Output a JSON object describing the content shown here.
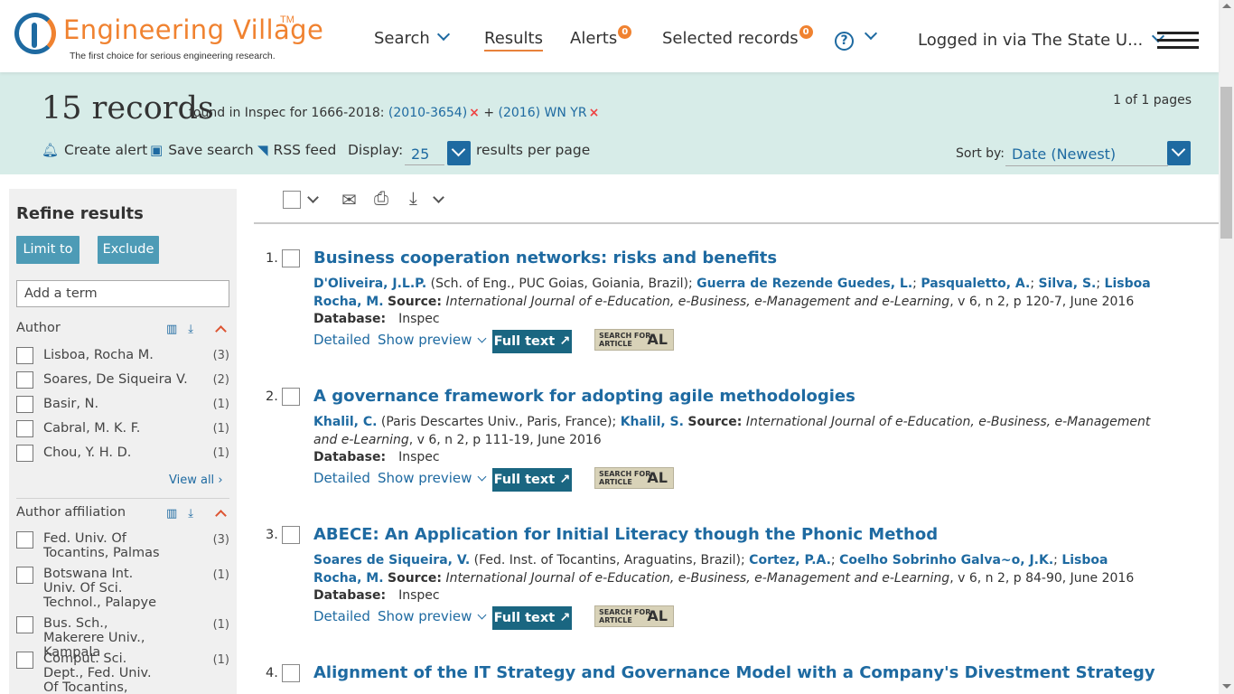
{
  "header": {
    "logo_name": "Engineering Village",
    "logo_tm": "TM",
    "logo_tagline": "The first choice for serious engineering research.",
    "nav": {
      "search": "Search",
      "results": "Results",
      "alerts": "Alerts",
      "alerts_count": "0",
      "selected": "Selected records",
      "selected_count": "0",
      "help": "?",
      "login": "Logged in via The State U..."
    }
  },
  "banner": {
    "count": "15 records",
    "found_text": "found in Inspec for 1666-2018:",
    "query1": "(2010-3654)",
    "plus": "+",
    "query2": "(2016) WN YR",
    "remove_glyph": "×",
    "pages": "1 of 1 pages",
    "create_alert": "Create alert",
    "save_search": "Save search",
    "rss_feed": "RSS feed",
    "display_label": "Display:",
    "display_value": "25",
    "per_page": "results per page",
    "sort_label": "Sort by:",
    "sort_value": "Date (Newest)"
  },
  "sidebar": {
    "title": "Refine results",
    "limit_to": "Limit to",
    "exclude": "Exclude",
    "add_term_placeholder": "Add a term",
    "author_head": "Author",
    "authors": [
      {
        "label": "Lisboa, Rocha M.",
        "count": "(3)"
      },
      {
        "label": "Soares, De Siqueira V.",
        "count": "(2)"
      },
      {
        "label": "Basir, N.",
        "count": "(1)"
      },
      {
        "label": "Cabral, M. K. F.",
        "count": "(1)"
      },
      {
        "label": "Chou, Y. H. D.",
        "count": "(1)"
      }
    ],
    "view_all": "View all",
    "affiliation_head": "Author affiliation",
    "affiliations": [
      {
        "label": "Fed. Univ. Of Tocantins, Palmas",
        "count": "(3)"
      },
      {
        "label": "Botswana Int. Univ. Of Sci. Technol., Palapye",
        "count": "(1)"
      },
      {
        "label": "Bus. Sch., Makerere Univ., Kampala",
        "count": "(1)"
      },
      {
        "label": "Comput. Sci. Dept., Fed. Univ. Of Tocantins, Palmas",
        "count": "(1)"
      }
    ]
  },
  "results": [
    {
      "num": "1.",
      "title": "Business cooperation networks: risks and benefits",
      "author1": "D'Oliveira, J.L.P.",
      "affil": "(Sch. of Eng., PUC Goias, Goiania, Brazil);",
      "others": [
        "Guerra de Rezende Guedes, L.",
        "Pasqualetto, A.",
        "Silva, S.",
        "Lisboa Rocha, M."
      ],
      "source_label": "Source:",
      "journal": "International Journal of e-Education, e-Business, e-Management and e-Learning",
      "citation": ", v 6, n 2, p 120-7, June 2016"
    },
    {
      "num": "2.",
      "title": "A governance framework for adopting agile methodologies",
      "author1": "Khalil, C.",
      "affil": "(Paris Descartes Univ., Paris, France);",
      "others": [
        "Khalil, S."
      ],
      "source_label": "Source:",
      "journal": "International Journal of e-Education, e-Business, e-Management and e-Learning",
      "citation": ", v 6, n 2, p 111-19, June 2016"
    },
    {
      "num": "3.",
      "title": "ABECE: An Application for Initial Literacy though the Phonic Method",
      "author1": "Soares de Siqueira, V.",
      "affil": "(Fed. Inst. of Tocantins, Araguatins, Brazil);",
      "others": [
        "Cortez, P.A.",
        "Coelho Sobrinho Galva~o, J.K.",
        "Lisboa Rocha, M."
      ],
      "source_label": "Source:",
      "journal": "International Journal of e-Education, e-Business, e-Management and e-Learning",
      "citation": ", v 6, n 2, p 84-90, June 2016"
    },
    {
      "num": "4.",
      "title": "Alignment of the IT Strategy and Governance Model with a Company's Divestment Strategy"
    }
  ],
  "result_common": {
    "database_label": "Database:",
    "database_value": "Inspec",
    "detailed": "Detailed",
    "show_preview": "Show preview",
    "full_text": "Full text",
    "full_text_glyph": "↗",
    "afl_line1": "SEARCH FOR",
    "afl_line2": "ARTICLE",
    "afl_mark": "AL"
  }
}
